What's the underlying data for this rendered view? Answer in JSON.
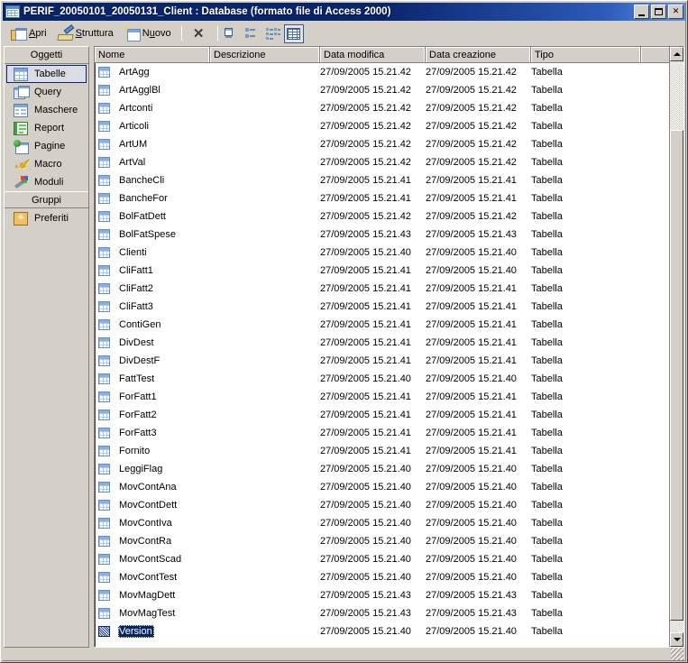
{
  "window": {
    "title": "PERIF_20050101_20050131_Client : Database (formato file di Access 2000)",
    "icon": "access-database-icon",
    "minimize_label": "_",
    "maximize_label": "□",
    "close_label": "✕"
  },
  "toolbar": {
    "items": [
      {
        "id": "apri",
        "label": "Apri",
        "accel": "A",
        "icon": "open-folder-table-icon"
      },
      {
        "id": "struttura",
        "label": "Struttura",
        "accel": "S",
        "icon": "design-ruler-pencil-icon"
      },
      {
        "id": "nuovo",
        "label": "Nuovo",
        "accel": "u",
        "icon": "new-table-sparkle-icon"
      }
    ],
    "delete_label": "✕",
    "delete_icon": "delete-x-icon",
    "views": [
      {
        "id": "large-icons",
        "icon": "view-large-icons-icon",
        "selected": false
      },
      {
        "id": "small-icons",
        "icon": "view-small-icons-icon",
        "selected": false
      },
      {
        "id": "list",
        "icon": "view-list-icon",
        "selected": false
      },
      {
        "id": "details",
        "icon": "view-details-icon",
        "selected": true
      }
    ]
  },
  "sidebar": {
    "objects_header": "Oggetti",
    "objects": [
      {
        "label": "Tabelle",
        "icon": "table-icon",
        "active": true
      },
      {
        "label": "Query",
        "icon": "query-icon",
        "active": false
      },
      {
        "label": "Maschere",
        "icon": "form-icon",
        "active": false
      },
      {
        "label": "Report",
        "icon": "report-icon",
        "active": false
      },
      {
        "label": "Pagine",
        "icon": "page-icon",
        "active": false
      },
      {
        "label": "Macro",
        "icon": "macro-icon",
        "active": false
      },
      {
        "label": "Moduli",
        "icon": "module-icon",
        "active": false
      }
    ],
    "groups_header": "Gruppi",
    "groups": [
      {
        "label": "Preferiti",
        "icon": "favorites-folder-icon",
        "active": false
      }
    ]
  },
  "list": {
    "columns": [
      "Nome",
      "Descrizione",
      "Data modifica",
      "Data creazione",
      "Tipo"
    ],
    "rows": [
      {
        "nome": "ArtAgg",
        "descrizione": "",
        "modifica": "27/09/2005 15.21.42",
        "creazione": "27/09/2005 15.21.42",
        "tipo": "Tabella",
        "selected": false
      },
      {
        "nome": "ArtAgglBl",
        "descrizione": "",
        "modifica": "27/09/2005 15.21.42",
        "creazione": "27/09/2005 15.21.42",
        "tipo": "Tabella",
        "selected": false
      },
      {
        "nome": "Artconti",
        "descrizione": "",
        "modifica": "27/09/2005 15.21.42",
        "creazione": "27/09/2005 15.21.42",
        "tipo": "Tabella",
        "selected": false
      },
      {
        "nome": "Articoli",
        "descrizione": "",
        "modifica": "27/09/2005 15.21.42",
        "creazione": "27/09/2005 15.21.42",
        "tipo": "Tabella",
        "selected": false
      },
      {
        "nome": "ArtUM",
        "descrizione": "",
        "modifica": "27/09/2005 15.21.42",
        "creazione": "27/09/2005 15.21.42",
        "tipo": "Tabella",
        "selected": false
      },
      {
        "nome": "ArtVal",
        "descrizione": "",
        "modifica": "27/09/2005 15.21.42",
        "creazione": "27/09/2005 15.21.42",
        "tipo": "Tabella",
        "selected": false
      },
      {
        "nome": "BancheCli",
        "descrizione": "",
        "modifica": "27/09/2005 15.21.41",
        "creazione": "27/09/2005 15.21.41",
        "tipo": "Tabella",
        "selected": false
      },
      {
        "nome": "BancheFor",
        "descrizione": "",
        "modifica": "27/09/2005 15.21.41",
        "creazione": "27/09/2005 15.21.41",
        "tipo": "Tabella",
        "selected": false
      },
      {
        "nome": "BolFatDett",
        "descrizione": "",
        "modifica": "27/09/2005 15.21.42",
        "creazione": "27/09/2005 15.21.42",
        "tipo": "Tabella",
        "selected": false
      },
      {
        "nome": "BolFatSpese",
        "descrizione": "",
        "modifica": "27/09/2005 15.21.43",
        "creazione": "27/09/2005 15.21.43",
        "tipo": "Tabella",
        "selected": false
      },
      {
        "nome": "Clienti",
        "descrizione": "",
        "modifica": "27/09/2005 15.21.40",
        "creazione": "27/09/2005 15.21.40",
        "tipo": "Tabella",
        "selected": false
      },
      {
        "nome": "CliFatt1",
        "descrizione": "",
        "modifica": "27/09/2005 15.21.41",
        "creazione": "27/09/2005 15.21.40",
        "tipo": "Tabella",
        "selected": false
      },
      {
        "nome": "CliFatt2",
        "descrizione": "",
        "modifica": "27/09/2005 15.21.41",
        "creazione": "27/09/2005 15.21.41",
        "tipo": "Tabella",
        "selected": false
      },
      {
        "nome": "CliFatt3",
        "descrizione": "",
        "modifica": "27/09/2005 15.21.41",
        "creazione": "27/09/2005 15.21.41",
        "tipo": "Tabella",
        "selected": false
      },
      {
        "nome": "ContiGen",
        "descrizione": "",
        "modifica": "27/09/2005 15.21.41",
        "creazione": "27/09/2005 15.21.41",
        "tipo": "Tabella",
        "selected": false
      },
      {
        "nome": "DivDest",
        "descrizione": "",
        "modifica": "27/09/2005 15.21.41",
        "creazione": "27/09/2005 15.21.41",
        "tipo": "Tabella",
        "selected": false
      },
      {
        "nome": "DivDestF",
        "descrizione": "",
        "modifica": "27/09/2005 15.21.41",
        "creazione": "27/09/2005 15.21.41",
        "tipo": "Tabella",
        "selected": false
      },
      {
        "nome": "FattTest",
        "descrizione": "",
        "modifica": "27/09/2005 15.21.40",
        "creazione": "27/09/2005 15.21.40",
        "tipo": "Tabella",
        "selected": false
      },
      {
        "nome": "ForFatt1",
        "descrizione": "",
        "modifica": "27/09/2005 15.21.41",
        "creazione": "27/09/2005 15.21.41",
        "tipo": "Tabella",
        "selected": false
      },
      {
        "nome": "ForFatt2",
        "descrizione": "",
        "modifica": "27/09/2005 15.21.41",
        "creazione": "27/09/2005 15.21.41",
        "tipo": "Tabella",
        "selected": false
      },
      {
        "nome": "ForFatt3",
        "descrizione": "",
        "modifica": "27/09/2005 15.21.41",
        "creazione": "27/09/2005 15.21.41",
        "tipo": "Tabella",
        "selected": false
      },
      {
        "nome": "Fornito",
        "descrizione": "",
        "modifica": "27/09/2005 15.21.41",
        "creazione": "27/09/2005 15.21.41",
        "tipo": "Tabella",
        "selected": false
      },
      {
        "nome": "LeggiFlag",
        "descrizione": "",
        "modifica": "27/09/2005 15.21.40",
        "creazione": "27/09/2005 15.21.40",
        "tipo": "Tabella",
        "selected": false
      },
      {
        "nome": "MovContAna",
        "descrizione": "",
        "modifica": "27/09/2005 15.21.40",
        "creazione": "27/09/2005 15.21.40",
        "tipo": "Tabella",
        "selected": false
      },
      {
        "nome": "MovContDett",
        "descrizione": "",
        "modifica": "27/09/2005 15.21.40",
        "creazione": "27/09/2005 15.21.40",
        "tipo": "Tabella",
        "selected": false
      },
      {
        "nome": "MovContIva",
        "descrizione": "",
        "modifica": "27/09/2005 15.21.40",
        "creazione": "27/09/2005 15.21.40",
        "tipo": "Tabella",
        "selected": false
      },
      {
        "nome": "MovContRa",
        "descrizione": "",
        "modifica": "27/09/2005 15.21.40",
        "creazione": "27/09/2005 15.21.40",
        "tipo": "Tabella",
        "selected": false
      },
      {
        "nome": "MovContScad",
        "descrizione": "",
        "modifica": "27/09/2005 15.21.40",
        "creazione": "27/09/2005 15.21.40",
        "tipo": "Tabella",
        "selected": false
      },
      {
        "nome": "MovContTest",
        "descrizione": "",
        "modifica": "27/09/2005 15.21.40",
        "creazione": "27/09/2005 15.21.40",
        "tipo": "Tabella",
        "selected": false
      },
      {
        "nome": "MovMagDett",
        "descrizione": "",
        "modifica": "27/09/2005 15.21.43",
        "creazione": "27/09/2005 15.21.43",
        "tipo": "Tabella",
        "selected": false
      },
      {
        "nome": "MovMagTest",
        "descrizione": "",
        "modifica": "27/09/2005 15.21.43",
        "creazione": "27/09/2005 15.21.43",
        "tipo": "Tabella",
        "selected": false
      },
      {
        "nome": "Version",
        "descrizione": "",
        "modifica": "27/09/2005 15.21.40",
        "creazione": "27/09/2005 15.21.40",
        "tipo": "Tabella",
        "selected": true
      }
    ]
  },
  "scrollbar": {
    "up_icon": "scroll-up-arrow-icon",
    "down_icon": "scroll-down-arrow-icon",
    "thumb_top_pct": 12,
    "thumb_height_pct": 86
  },
  "colors": {
    "titlebar_start": "#0a246a",
    "titlebar_end": "#5c8ede",
    "face": "#d4d0c8",
    "selection": "#0a246a",
    "list_bg": "#ffffff"
  }
}
